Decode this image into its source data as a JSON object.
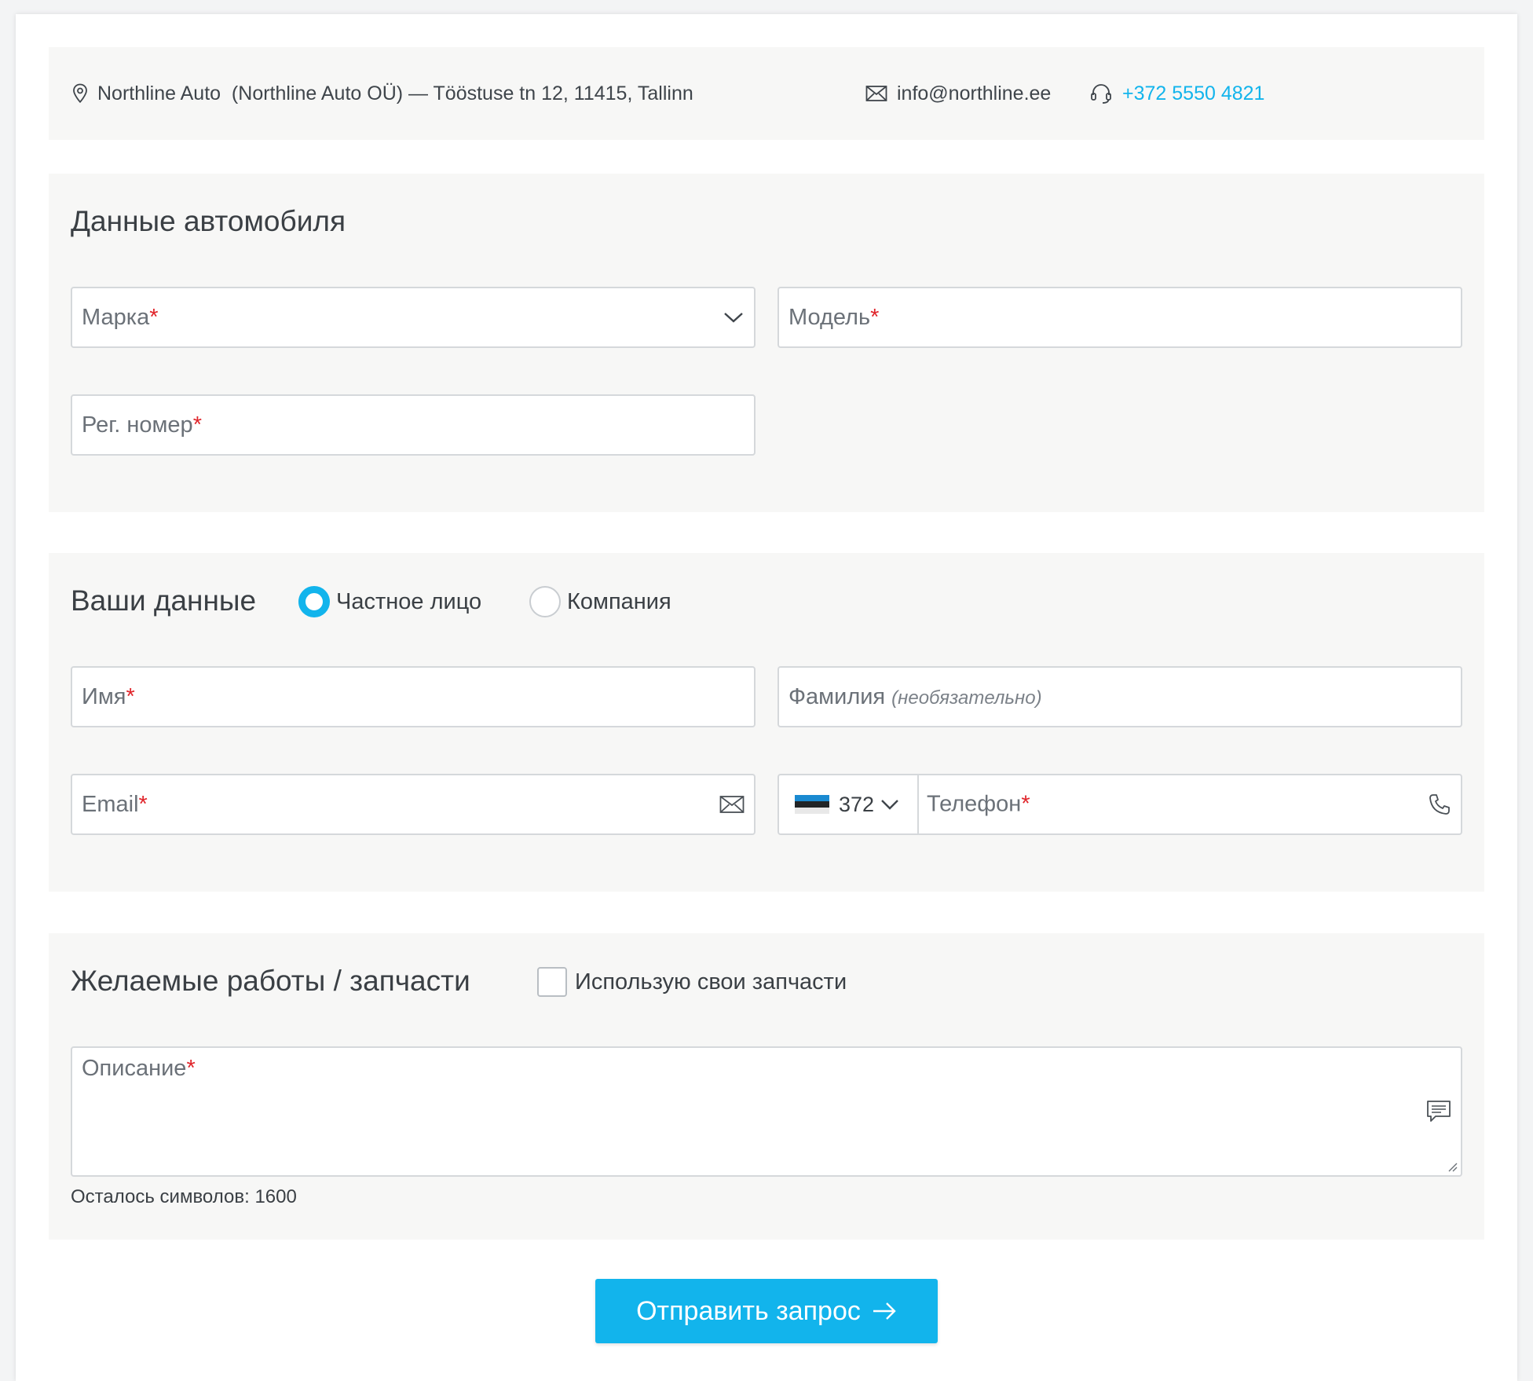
{
  "contact": {
    "address": "Northline Auto  (Northline Auto OÜ) — Tööstuse tn 12, 11415, Tallinn",
    "email": "info@northline.ee",
    "phone": "+372 5550 4821"
  },
  "vehicle": {
    "title": "Данные автомобиля",
    "make_label": "Марка",
    "model_label": "Модель",
    "reg_label": "Рег. номер",
    "required_mark": "*"
  },
  "customer": {
    "title": "Ваши данные",
    "type_private": "Частное лицо",
    "type_company": "Компания",
    "selected_type": "Частное лицо",
    "first_name_label": "Имя",
    "last_name_label": "Фамилия",
    "optional_note": "(необязательно)",
    "email_label": "Email",
    "country_code": "372",
    "phone_label": "Телефон",
    "required_mark": "*"
  },
  "work": {
    "title": "Желаемые работы / запчасти",
    "own_parts_label": "Использую свои запчасти",
    "own_parts_checked": false,
    "description_label": "Описание",
    "required_mark": "*",
    "chars_left": "Осталось символов: 1600"
  },
  "submit": {
    "label": "Отправить запрос"
  },
  "icons": [
    "location-pin-icon",
    "envelope-icon",
    "headset-icon",
    "chevron-down-icon",
    "phone-icon",
    "comment-icon",
    "arrow-right-icon",
    "estonia-flag-icon"
  ],
  "colors": {
    "accent": "#12b4ec",
    "required": "#e0252b",
    "panel": "#f7f7f6"
  }
}
